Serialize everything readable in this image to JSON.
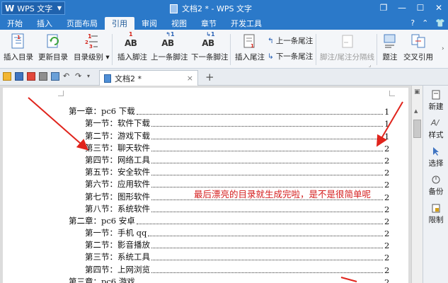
{
  "titlebar": {
    "app_logo": "W",
    "app_name": "WPS 文字",
    "window_title": "文档2 * - WPS 文字"
  },
  "menu": {
    "tabs": [
      "开始",
      "插入",
      "页面布局",
      "引用",
      "审阅",
      "视图",
      "章节",
      "开发工具"
    ],
    "active_tab": "引用"
  },
  "ribbon": {
    "insert_toc": "插入目录",
    "update_toc": "更新目录",
    "toc_level": "目录级别",
    "insert_footnote": "插入脚注",
    "prev_footnote": "上一条脚注",
    "next_footnote": "下一条脚注",
    "insert_endnote": "插入尾注",
    "prev_endnote": "上一条尾注",
    "next_endnote": "下一条尾注",
    "footnote_separator": "脚注/尾注分隔线",
    "caption": "题注",
    "cross_ref": "交叉引用"
  },
  "doc_tab": {
    "title": "文档2 *"
  },
  "toc": [
    {
      "level": 1,
      "text": "第一章：pc6 下载",
      "page": "1"
    },
    {
      "level": 2,
      "text": "第一节：软件下载",
      "page": "1"
    },
    {
      "level": 2,
      "text": "第二节：游戏下载",
      "page": "1"
    },
    {
      "level": 2,
      "text": "第三节：聊天软件",
      "page": "2"
    },
    {
      "level": 2,
      "text": "第四节：网络工具",
      "page": "2"
    },
    {
      "level": 2,
      "text": "第五节：安全软件",
      "page": "2"
    },
    {
      "level": 2,
      "text": "第六节：应用软件",
      "page": "2"
    },
    {
      "level": 2,
      "text": "第七节：图形软件",
      "page": "2"
    },
    {
      "level": 2,
      "text": "第八节：系统软件",
      "page": "2"
    },
    {
      "level": 1,
      "text": "第二章：pc6 安卓",
      "page": "2"
    },
    {
      "level": 2,
      "text": "第一节：手机 qq",
      "page": "2"
    },
    {
      "level": 2,
      "text": "第二节：影音播放",
      "page": "2"
    },
    {
      "level": 2,
      "text": "第三节：系统工具",
      "page": "2"
    },
    {
      "level": 2,
      "text": "第四节：上网浏览",
      "page": "2"
    },
    {
      "level": 1,
      "text": "第三章：pc6 游戏",
      "page": "2"
    }
  ],
  "annotation": "最后漂亮的目录就生成完啦，是不是很简单呢",
  "sidepanel": {
    "new": "新建",
    "style": "样式",
    "select": "选择",
    "backup": "备份",
    "limit": "限制"
  },
  "colors": {
    "titlebar": "#2b79c9",
    "annotation": "#d41d1d",
    "ribbon_bg": "#f4f6f9"
  }
}
